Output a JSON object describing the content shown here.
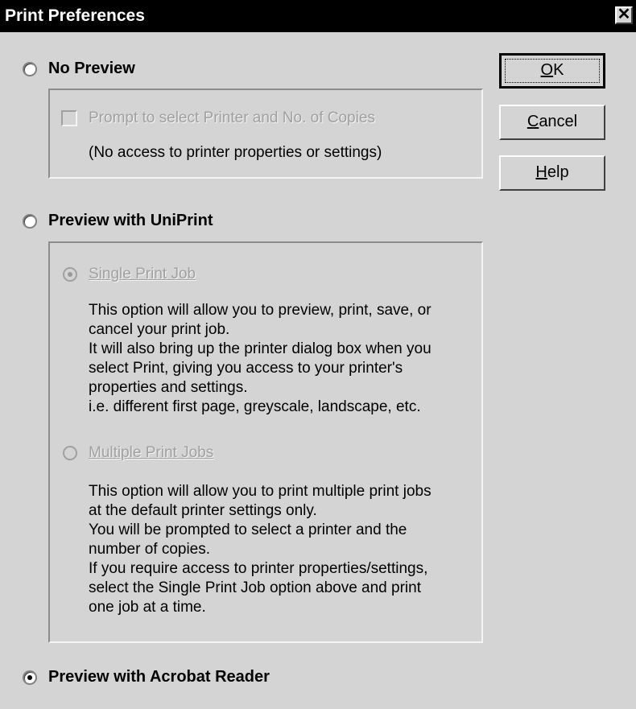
{
  "window": {
    "title": "Print Preferences",
    "close_glyph": "✕"
  },
  "options": {
    "no_preview": {
      "label": "No Preview",
      "checked": false
    },
    "preview_uniprint": {
      "label": "Preview with UniPrint",
      "checked": false
    },
    "preview_acrobat": {
      "label": "Preview with Acrobat Reader",
      "checked": true
    }
  },
  "no_preview_group": {
    "checkbox_label": "Prompt to select Printer and No. of Copies",
    "checkbox_checked": false,
    "note": "(No access to printer properties or settings)"
  },
  "uniprint_group": {
    "single": {
      "label": "Single Print Job",
      "checked": true,
      "lines": [
        "This option will allow you to preview, print, save, or",
        "cancel your print job.",
        "It will also bring up the printer dialog box when you",
        "select Print, giving you access to your printer's",
        "properties and settings.",
        "i.e. different first page, greyscale, landscape, etc."
      ]
    },
    "multiple": {
      "label": "Multiple Print Jobs",
      "checked": false,
      "lines": [
        "This option will allow you to print multiple print jobs",
        "at the default printer settings only.",
        "You will be prompted to select a printer and the",
        "number of copies.",
        "If you require access to printer properties/settings,",
        "select the Single Print Job option above and print",
        "one job at a time."
      ]
    }
  },
  "buttons": {
    "ok": {
      "mnemonic": "O",
      "rest": "K"
    },
    "cancel": {
      "mnemonic": "C",
      "rest": "ancel"
    },
    "help": {
      "mnemonic": "H",
      "rest": "elp"
    }
  }
}
